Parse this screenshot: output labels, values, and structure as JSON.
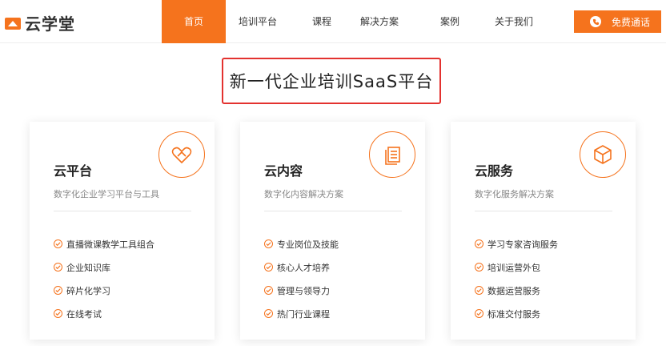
{
  "brand": {
    "name": "云学堂",
    "color": "#f5731d"
  },
  "nav": {
    "items": [
      {
        "label": "首页",
        "active": true
      },
      {
        "label": "培训平台",
        "active": false
      },
      {
        "label": "课程",
        "active": false
      },
      {
        "label": "解决方案",
        "active": false
      },
      {
        "label": "案例",
        "active": false
      },
      {
        "label": "关于我们",
        "active": false
      }
    ],
    "call_label": "免费通话"
  },
  "hero": {
    "title": "新一代企业培训SaaS平台",
    "border_color": "#e3322f"
  },
  "cards": [
    {
      "icon": "heart-link-icon",
      "title": "云平台",
      "subtitle": "数字化企业学习平台与工具",
      "features": [
        "直播微课教学工具组合",
        "企业知识库",
        "碎片化学习",
        "在线考试"
      ]
    },
    {
      "icon": "document-stack-icon",
      "title": "云内容",
      "subtitle": "数字化内容解决方案",
      "features": [
        "专业岗位及技能",
        "核心人才培养",
        "管理与领导力",
        "热门行业课程"
      ]
    },
    {
      "icon": "cube-icon",
      "title": "云服务",
      "subtitle": "数字化服务解决方案",
      "features": [
        "学习专家咨询服务",
        "培训运营外包",
        "数据运营服务",
        "标准交付服务"
      ]
    }
  ]
}
